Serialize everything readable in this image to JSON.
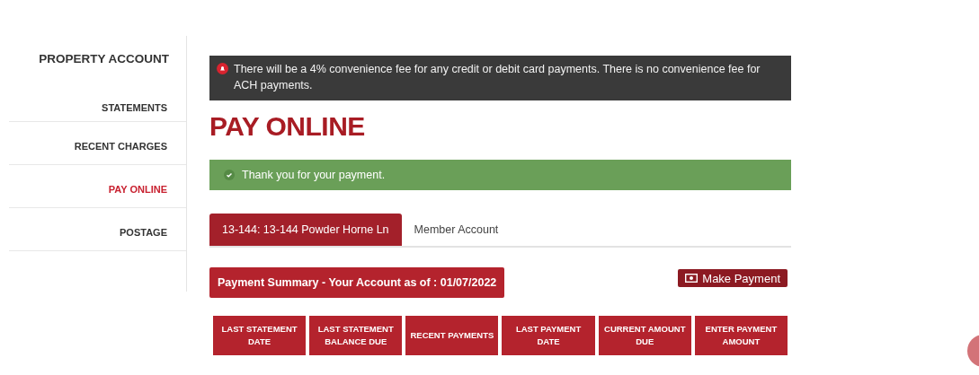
{
  "sidebar": {
    "heading": "PROPERTY ACCOUNT",
    "items": [
      {
        "label": "STATEMENTS",
        "selected": false
      },
      {
        "label": "RECENT CHARGES",
        "selected": false
      },
      {
        "label": "PAY ONLINE",
        "selected": true
      },
      {
        "label": "POSTAGE",
        "selected": false
      }
    ]
  },
  "notice": {
    "text": "There will be a 4% convenience fee for any credit or debit card payments. There is no convenience fee for ACH payments."
  },
  "page_title": "PAY ONLINE",
  "success": {
    "text": "Thank you for your payment."
  },
  "tabs": [
    {
      "label": "13-144: 13-144 Powder Horne Ln",
      "selected": true
    },
    {
      "label": "Member Account",
      "selected": false
    }
  ],
  "summary_title": "Payment Summary - Your Account as of : 01/07/2022",
  "make_payment": "Make Payment",
  "table": {
    "columns": [
      "LAST STATEMENT DATE",
      "LAST STATEMENT BALANCE DUE",
      "RECENT PAYMENTS",
      "LAST PAYMENT DATE",
      "CURRENT AMOUNT DUE",
      "ENTER PAYMENT AMOUNT"
    ]
  }
}
